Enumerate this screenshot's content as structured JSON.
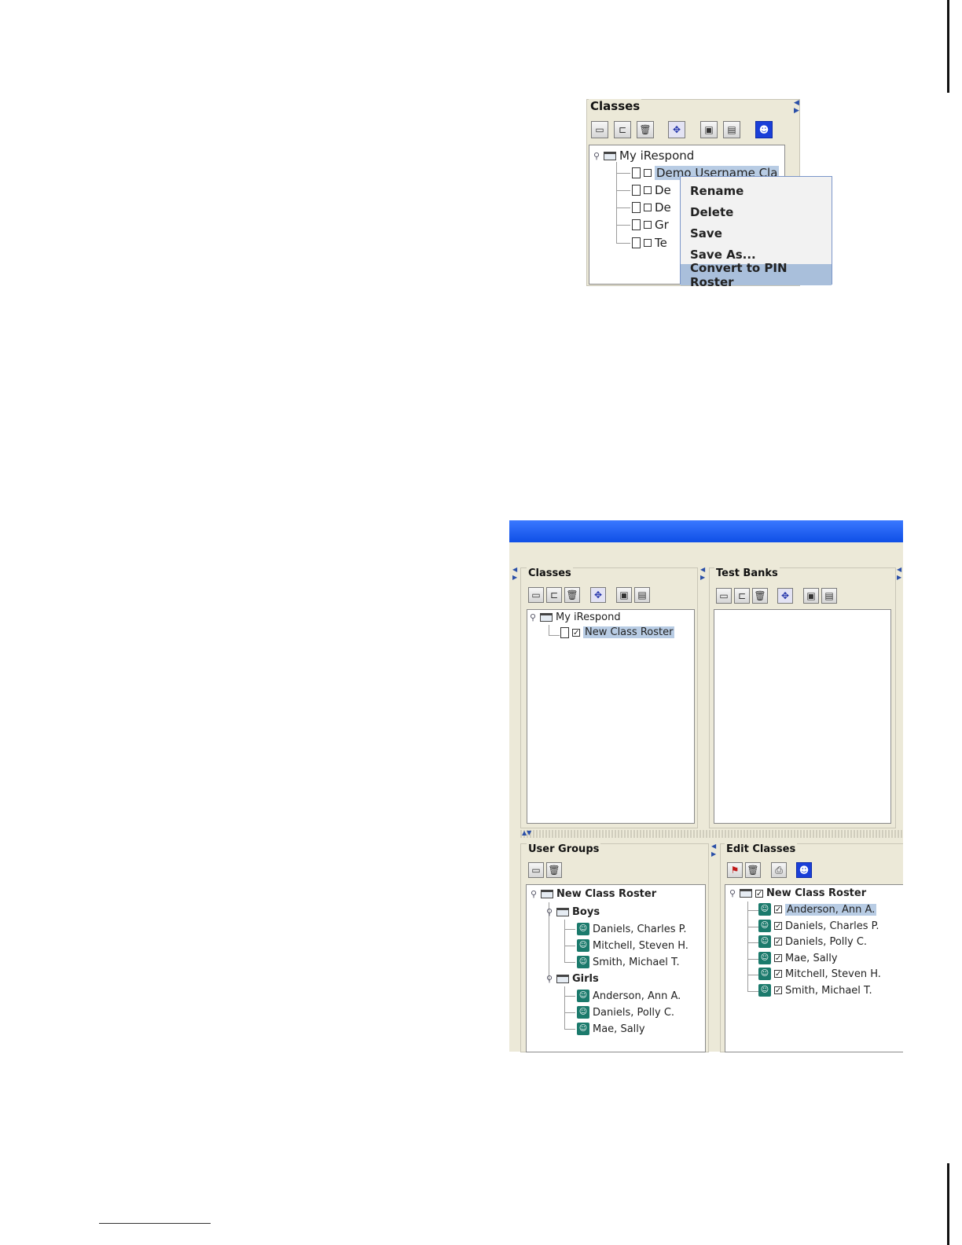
{
  "top_panel": {
    "title": "Classes",
    "root": "My iRespond",
    "items": [
      "Demo Username Cla",
      "De",
      "De",
      "Gr",
      "Te"
    ],
    "context_menu": [
      "Rename",
      "Delete",
      "Save",
      "Save As...",
      "Convert to PIN Roster"
    ],
    "highlighted_menu_item": "Convert to PIN Roster"
  },
  "app": {
    "classes": {
      "title": "Classes",
      "root": "My iRespond",
      "items": [
        "New Class Roster"
      ]
    },
    "test_banks": {
      "title": "Test Banks"
    },
    "user_groups": {
      "title": "User Groups",
      "root": "New Class Roster",
      "groups": [
        {
          "name": "Boys",
          "members": [
            "Daniels, Charles P.",
            "Mitchell, Steven H.",
            "Smith, Michael T."
          ]
        },
        {
          "name": "Girls",
          "members": [
            "Anderson, Ann A.",
            "Daniels, Polly C.",
            "Mae, Sally"
          ]
        }
      ]
    },
    "edit_classes": {
      "title": "Edit Classes",
      "root": "New Class Roster",
      "members": [
        "Anderson, Ann A.",
        "Daniels, Charles P.",
        "Daniels, Polly C.",
        "Mae, Sally",
        "Mitchell, Steven H.",
        "Smith, Michael T."
      ],
      "selected": "Anderson, Ann A."
    }
  },
  "colors": {
    "titlebar": "#1458f0",
    "selection": "#b8cce4",
    "menu_highlight": "#a9bfdb"
  }
}
